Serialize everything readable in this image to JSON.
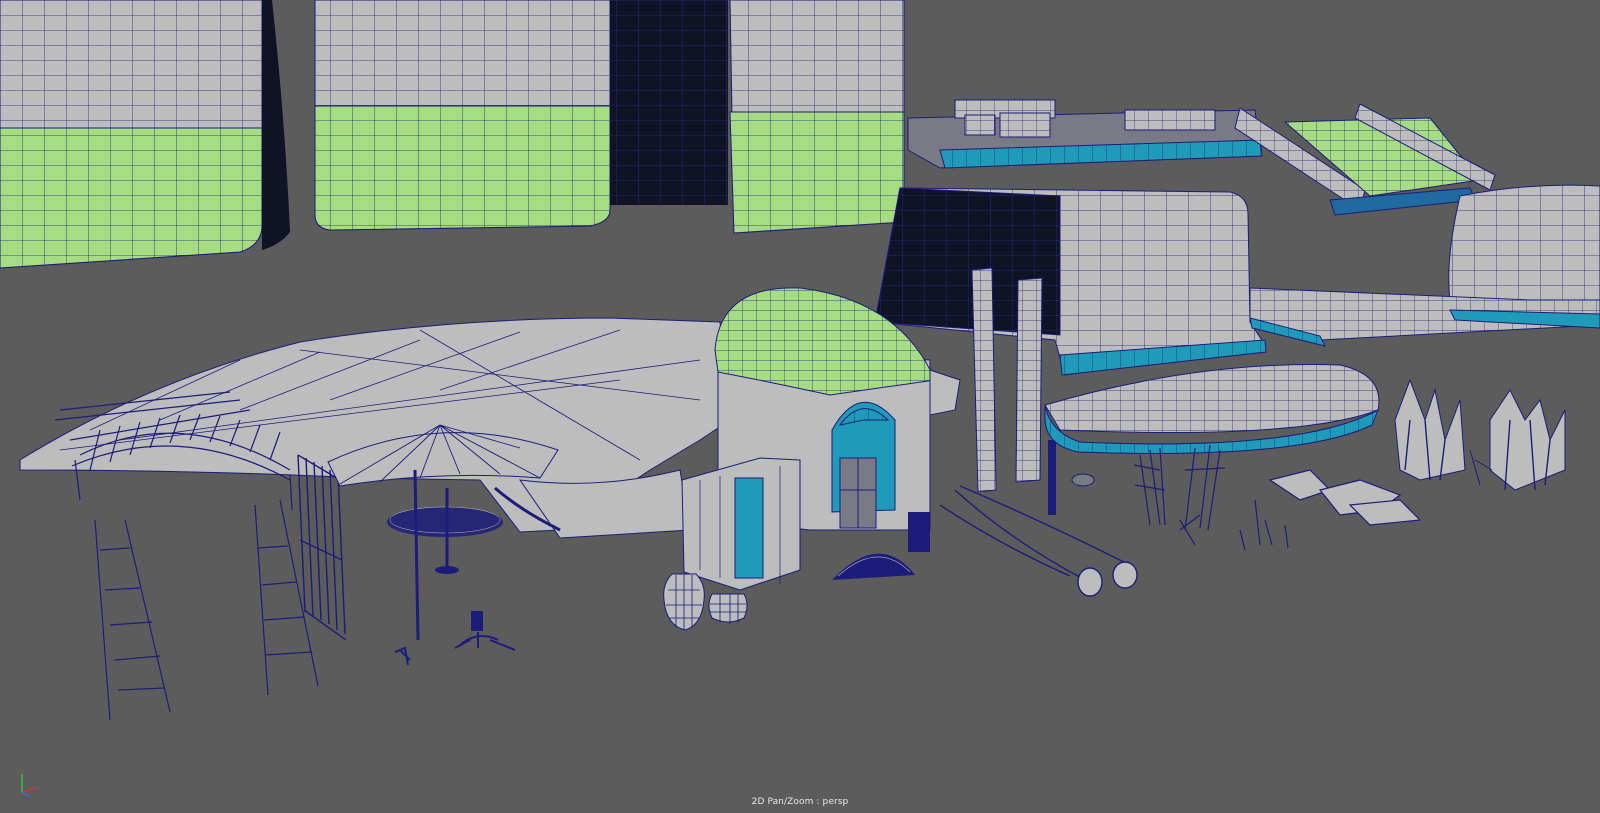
{
  "viewport": {
    "camera_label": "2D Pan/Zoom : persp",
    "background_color": "#5c5c5c"
  },
  "colors": {
    "wireframe": "#1c1c7a",
    "surface_gray": "#bdbdbd",
    "surface_green": "#a6dc82",
    "surface_teal": "#1f9ab8",
    "backface_dark": "#101226"
  },
  "gizmo": {
    "axes": [
      "x",
      "y",
      "z"
    ],
    "axis_colors": {
      "x": "#e03030",
      "y": "#3fd43f",
      "z": "#3a6cff"
    }
  }
}
